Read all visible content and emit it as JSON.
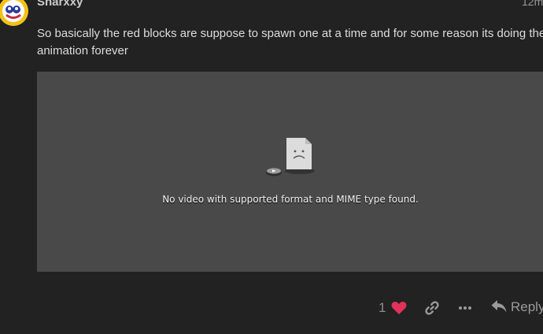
{
  "post": {
    "username": "Sharxxy",
    "timestamp": "12m",
    "body": "So basically the red blocks are suppose to spawn one at a time and for some reason its doing the animation forever"
  },
  "video": {
    "error_message": "No video with supported format and MIME type found."
  },
  "actions": {
    "like_count": "1",
    "reply_label": "Reply"
  },
  "colors": {
    "background": "#222222",
    "video_background": "#494949",
    "heart": "#e0325b"
  },
  "icons": {
    "avatar": "avatar",
    "video_error": "broken-video-icon",
    "like": "heart-icon",
    "link": "link-icon",
    "more": "ellipsis-icon",
    "reply": "reply-arrow-icon"
  }
}
